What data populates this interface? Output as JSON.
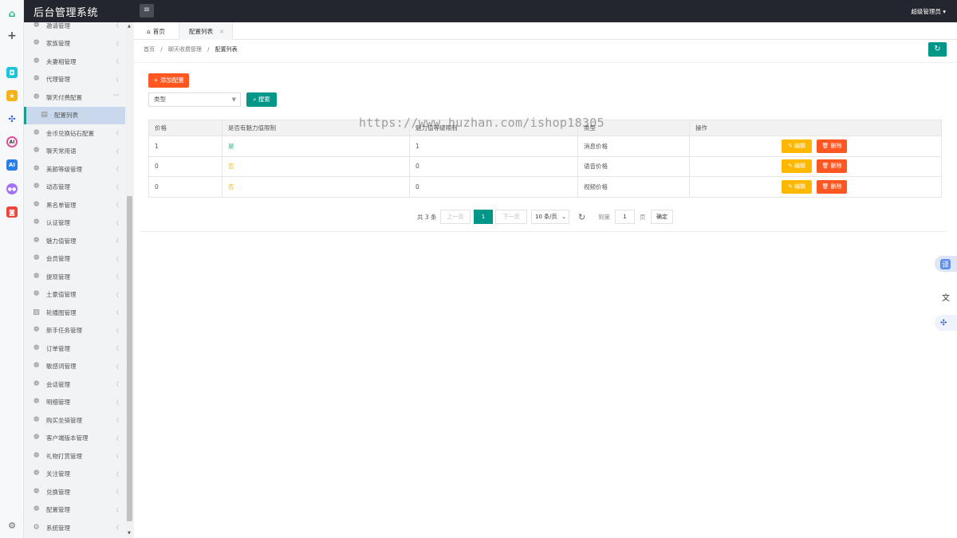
{
  "app": {
    "title": "后台管理系统",
    "user": "超级管理员"
  },
  "tabs": [
    {
      "label": "首页"
    },
    {
      "label": "配置列表"
    }
  ],
  "breadcrumb": [
    "首页",
    "聊天收费管理",
    "配置列表"
  ],
  "sidebar": {
    "items": [
      {
        "label": "邀请管理",
        "icon": "grid-icon"
      },
      {
        "label": "家族管理",
        "icon": "grid-icon"
      },
      {
        "label": "夫妻相管理",
        "icon": "grid-icon"
      },
      {
        "label": "代理管理",
        "icon": "grid-icon"
      },
      {
        "label": "聊天付费配置",
        "icon": "grid-icon",
        "expanded": true
      },
      {
        "label": "配置列表",
        "icon": "doc-icon",
        "sub": true
      },
      {
        "label": "金币兑换钻石配置",
        "icon": "grid-icon"
      },
      {
        "label": "聊天常用语",
        "icon": "grid-icon"
      },
      {
        "label": "美颜等级管理",
        "icon": "grid-icon"
      },
      {
        "label": "动态管理",
        "icon": "grid-icon"
      },
      {
        "label": "黑名单管理",
        "icon": "grid-icon"
      },
      {
        "label": "认证管理",
        "icon": "grid-icon"
      },
      {
        "label": "魅力值管理",
        "icon": "grid-icon"
      },
      {
        "label": "会员管理",
        "icon": "grid-icon"
      },
      {
        "label": "提现管理",
        "icon": "grid-icon"
      },
      {
        "label": "土豪值管理",
        "icon": "grid-icon"
      },
      {
        "label": "轮播图管理",
        "icon": "image-icon"
      },
      {
        "label": "新手任务管理",
        "icon": "grid-icon"
      },
      {
        "label": "订单管理",
        "icon": "grid-icon"
      },
      {
        "label": "敏感词管理",
        "icon": "grid-icon"
      },
      {
        "label": "会话管理",
        "icon": "grid-icon"
      },
      {
        "label": "明细管理",
        "icon": "grid-icon"
      },
      {
        "label": "购买坐骑管理",
        "icon": "grid-icon"
      },
      {
        "label": "客户端版本管理",
        "icon": "grid-icon"
      },
      {
        "label": "礼物打赏管理",
        "icon": "grid-icon"
      },
      {
        "label": "关注管理",
        "icon": "grid-icon"
      },
      {
        "label": "兑换管理",
        "icon": "grid-icon"
      },
      {
        "label": "配置管理",
        "icon": "grid-icon"
      },
      {
        "label": "系统管理",
        "icon": "gear-icon"
      }
    ]
  },
  "toolbar": {
    "add_label": "+ 添加配置",
    "select_placeholder": "类型",
    "search_label": "搜索"
  },
  "table": {
    "headers": [
      "价格",
      "是否有魅力值限制",
      "魅力值等级限制",
      "类型",
      "操作"
    ],
    "rows": [
      {
        "price": "1",
        "limit": "是",
        "level": "1",
        "type": "消息价格"
      },
      {
        "price": "0",
        "limit": "否",
        "level": "0",
        "type": "语音价格"
      },
      {
        "price": "0",
        "limit": "否",
        "level": "0",
        "type": "视频价格"
      }
    ],
    "edit_label": "编辑",
    "delete_label": "删除"
  },
  "pagination": {
    "total": "共 3 条",
    "prev": "上一页",
    "current": "1",
    "next": "下一页",
    "page_size": "10 条/页",
    "goto": "到第",
    "goto_value": "1",
    "page_unit": "页",
    "confirm": "确定"
  },
  "watermark": "https://www.huzhan.com/ishop18305",
  "colors": {
    "primary": "#009688",
    "danger": "#ff5722",
    "warning": "#ffb800",
    "header": "#23262e"
  }
}
